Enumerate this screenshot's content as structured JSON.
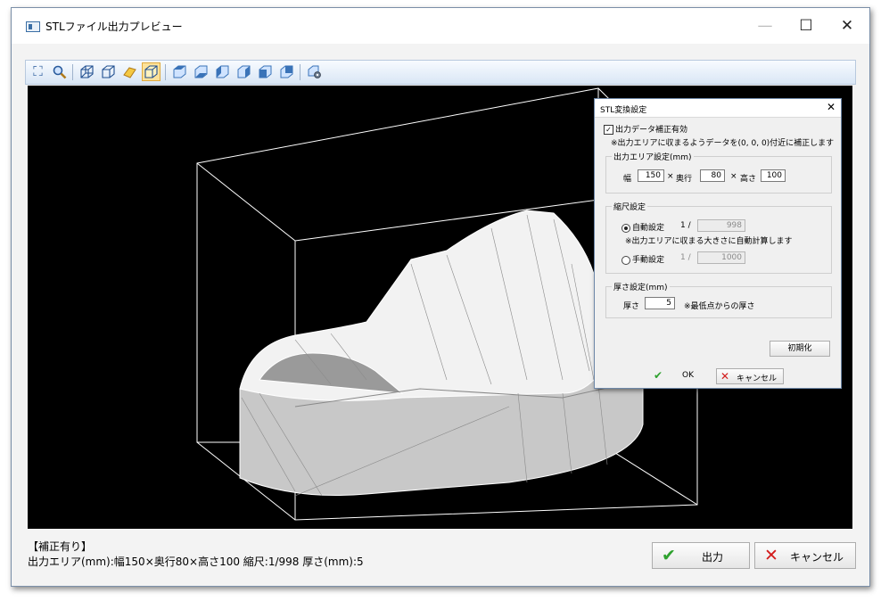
{
  "window": {
    "title": "STLファイル出力プレビュー",
    "minimize": "—",
    "maximize": "☐",
    "close": "✕"
  },
  "toolbar": {
    "buttons": [
      {
        "name": "fit-view-icon",
        "glyph": "⛶"
      },
      {
        "name": "zoom-icon",
        "glyph": "🔍"
      },
      {
        "name": "wireframe-iso-icon",
        "glyph": "⬡"
      },
      {
        "name": "wireframe-front-icon",
        "glyph": "⬡"
      },
      {
        "name": "shaded-icon",
        "glyph": "◆"
      },
      {
        "name": "box-view-icon",
        "glyph": "⬡"
      },
      {
        "name": "view-top-icon",
        "glyph": "⬡"
      },
      {
        "name": "view-bottom-icon",
        "glyph": "⬡"
      },
      {
        "name": "view-left-icon",
        "glyph": "⬡"
      },
      {
        "name": "view-right-icon",
        "glyph": "⬡"
      },
      {
        "name": "view-front-icon",
        "glyph": "⬡"
      },
      {
        "name": "view-back-icon",
        "glyph": "⬡"
      },
      {
        "name": "settings-icon",
        "glyph": "⚙"
      }
    ]
  },
  "status": {
    "line1": "【補正有り】",
    "line2": "出力エリア(mm):幅150×奥行80×高さ100 縮尺:1/998 厚さ(mm):5"
  },
  "buttons": {
    "output": "出力",
    "cancel": "キャンセル"
  },
  "dialog": {
    "title": "STL変換設定",
    "close": "✕",
    "correct_checkbox": "出力データ補正有効",
    "correct_note": "※出力エリアに収まるようデータを(0, 0, 0)付近に補正します",
    "area": {
      "legend": "出力エリア設定(mm)",
      "width_label": "幅",
      "width": "150",
      "times1": "×",
      "depth_label": "奥行",
      "depth": "80",
      "times2": "×",
      "height_label": "高さ",
      "height": "100"
    },
    "scale": {
      "legend": "縮尺設定",
      "auto_label": "自動設定",
      "auto_prefix": "1 /",
      "auto_value": "998",
      "auto_note": "※出力エリアに収まる大きさに自動計算します",
      "manual_label": "手動設定",
      "manual_prefix": "1 /",
      "manual_value": "1000"
    },
    "thickness": {
      "legend": "厚さ設定(mm)",
      "label": "厚さ",
      "value": "5",
      "note": "※最低点からの厚さ"
    },
    "reset": "初期化",
    "ok": "OK",
    "cancel": "キャンセル"
  }
}
